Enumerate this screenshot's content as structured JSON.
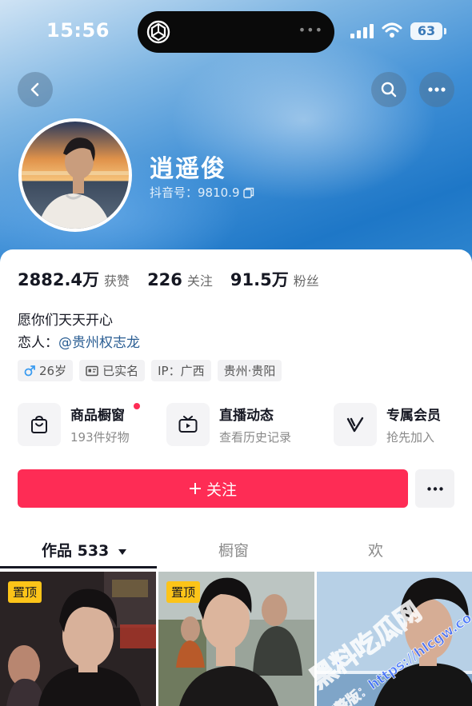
{
  "status": {
    "time": "15:56",
    "battery": "63"
  },
  "profile": {
    "name": "逍遥俊",
    "id_label": "抖音号：9810.9"
  },
  "stats": [
    {
      "num": "2882.4万",
      "label": "获赞"
    },
    {
      "num": "226",
      "label": "关注"
    },
    {
      "num": "91.5万",
      "label": "粉丝"
    }
  ],
  "bio": {
    "line1": "愿你们天天开心",
    "line2_prefix": "恋人：",
    "line2_mention": "@贵州权志龙"
  },
  "tags": {
    "age": "26岁",
    "verified": "已实名",
    "ip": "IP：广西",
    "location": "贵州·贵阳"
  },
  "features": [
    {
      "title": "商品橱窗",
      "sub": "193件好物",
      "icon": "shopping-bag-icon"
    },
    {
      "title": "直播动态",
      "sub": "查看历史记录",
      "icon": "tv-icon"
    },
    {
      "title": "专属会员",
      "sub": "抢先加入",
      "icon": "v-badge-icon"
    }
  ],
  "follow_label": "关注",
  "tabs": {
    "works": "作品 533",
    "window": "橱窗",
    "likes": "欢"
  },
  "thumbs": [
    {
      "pin": "置顶"
    },
    {
      "pin": "置顶"
    }
  ],
  "watermark": {
    "line1": "黑料吃瓜网",
    "line2": "看完整版：https://hlcgw.co"
  },
  "colors": {
    "accent": "#fe2c55",
    "mention": "#2b5e93",
    "pin": "#fcc419"
  }
}
